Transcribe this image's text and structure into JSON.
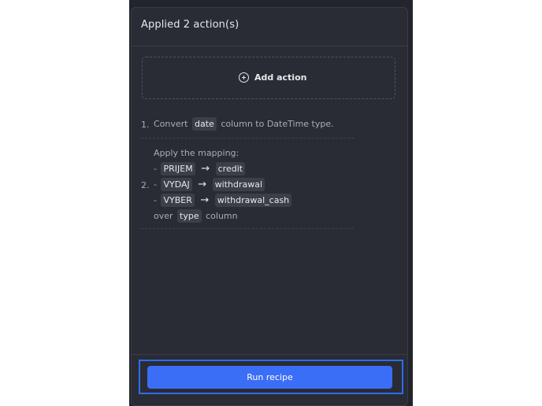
{
  "panel": {
    "title": "Applied 2 action(s)"
  },
  "add_action": {
    "label": "Add action",
    "icon": "plus-circle-icon"
  },
  "actions": [
    {
      "number": "1.",
      "parts": {
        "prefix": "Convert",
        "column": "date",
        "suffix": "column to DateTime type."
      }
    },
    {
      "number": "2.",
      "intro": "Apply the mapping:",
      "mappings": [
        {
          "dash": "-",
          "from": "PRIJEM",
          "arrow": "→",
          "to": "credit"
        },
        {
          "dash": "-",
          "from": "VYDAJ",
          "arrow": "→",
          "to": "withdrawal"
        },
        {
          "dash": "-",
          "from": "VYBER",
          "arrow": "→",
          "to": "withdrawal_cash"
        }
      ],
      "outro_prefix": "over",
      "outro_column": "type",
      "outro_suffix": "column"
    }
  ],
  "run_button": {
    "label": "Run recipe",
    "highlight_color": "#2e6cf0",
    "button_color": "#3b6ef6"
  }
}
